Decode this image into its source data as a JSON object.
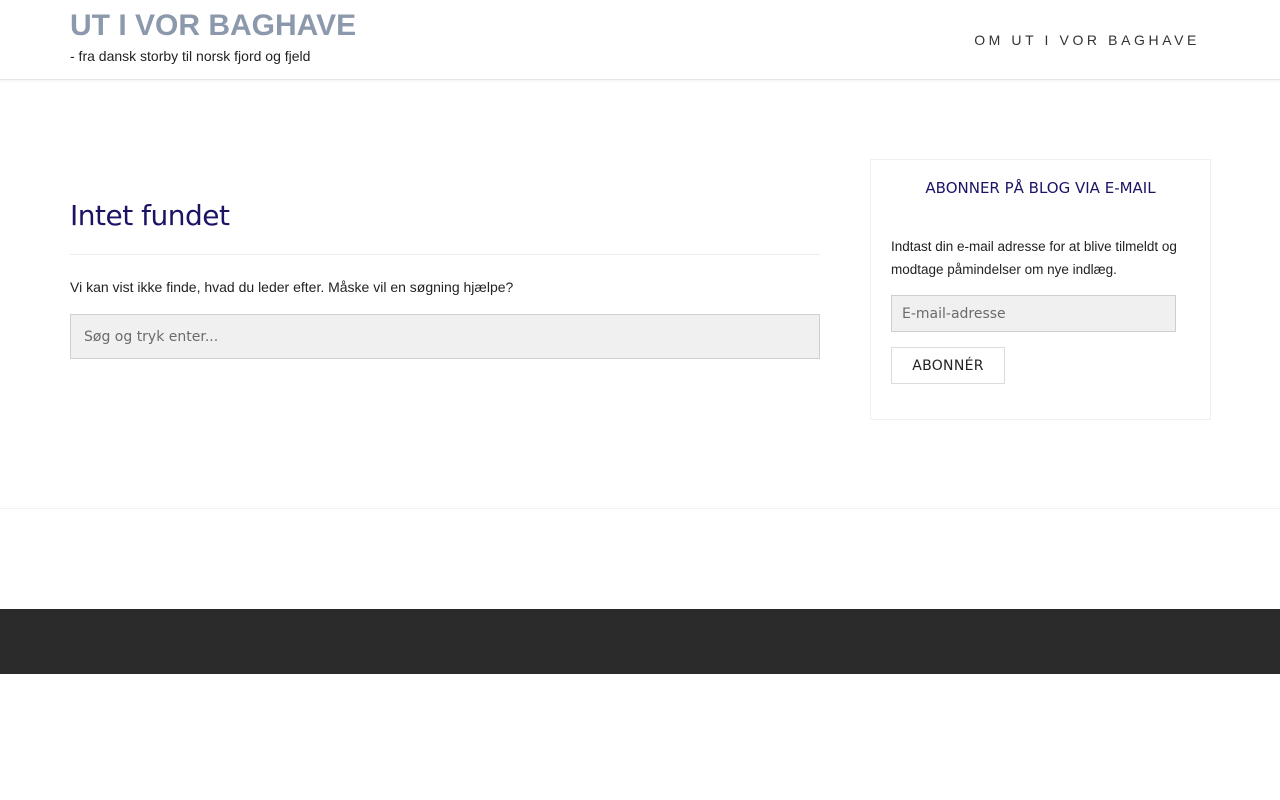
{
  "header": {
    "site_title": "UT I VOR BAGHAVE",
    "tagline": "- fra dansk storby til norsk fjord og fjeld",
    "nav": [
      {
        "label": "OM UT I VOR BAGHAVE"
      }
    ]
  },
  "main": {
    "page_title": "Intet fundet",
    "message": "Vi kan vist ikke finde, hvad du leder efter. Måske vil en søgning hjælpe?",
    "search": {
      "placeholder": "Søg og tryk enter...",
      "value": ""
    }
  },
  "sidebar": {
    "widget_title": "ABONNER PÅ BLOG VIA E-MAIL",
    "description": "Indtast din e-mail adresse for at blive tilmeldt og modtage påmindelser om nye indlæg.",
    "email": {
      "placeholder": "E-mail-adresse",
      "value": ""
    },
    "subscribe_label": "ABONNÉR"
  },
  "colors": {
    "site_title": "#8c99ad",
    "heading": "#1b1464",
    "footer_bg": "#2b2b2b",
    "input_bg": "#f0f0f0"
  }
}
